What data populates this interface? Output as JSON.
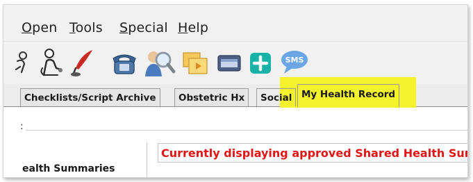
{
  "menubar": {
    "items": [
      {
        "underline": "O",
        "rest": "pen"
      },
      {
        "underline": "T",
        "rest": "ools"
      },
      {
        "underline": "S",
        "rest": "pecial"
      },
      {
        "underline": "H",
        "rest": "elp"
      }
    ]
  },
  "toolbar": {
    "icons": [
      "person-cut-icon",
      "stethoscope-icon",
      "quill-pen-icon",
      "phone-icon",
      "search-person-icon",
      "folder-stack-icon",
      "id-card-icon",
      "plus-icon",
      "sms-icon"
    ],
    "sms_text": "SMS"
  },
  "tabs": [
    {
      "label": "Checklists/Script Archive"
    },
    {
      "label": "Obstetric Hx"
    },
    {
      "label": "Social"
    },
    {
      "label": "My Health Record"
    }
  ],
  "content": {
    "colon": ":",
    "left_panel_title": "ealth Summaries",
    "banner_text": "Currently displaying approved Shared Health Summary"
  },
  "colors": {
    "highlight": "#f4f22a",
    "banner_text": "#e11515",
    "teal_button": "#18b2a6",
    "sms_bubble": "#6aa6e6"
  }
}
